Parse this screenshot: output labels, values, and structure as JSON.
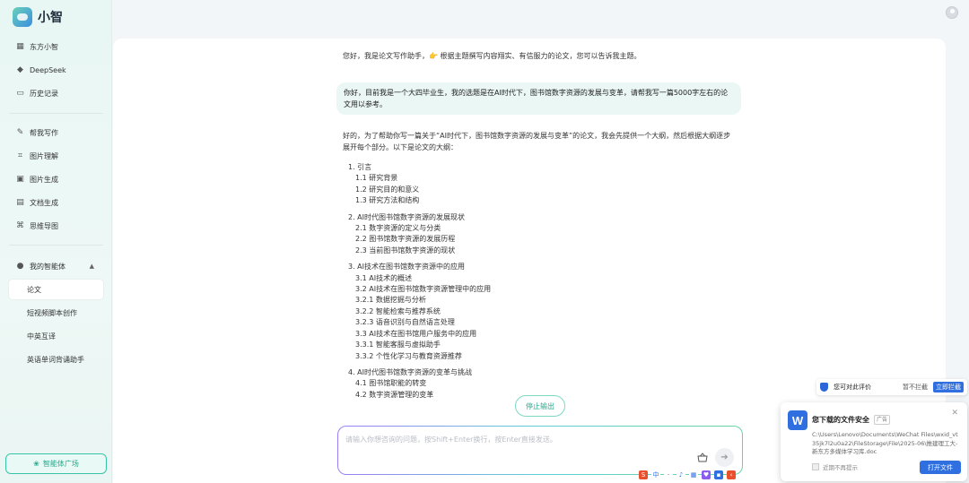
{
  "app": {
    "name": "小智"
  },
  "sidebar": {
    "top_items": [
      {
        "label": "东方小智",
        "icon": "grid-icon"
      },
      {
        "label": "DeepSeek",
        "icon": "whale-icon"
      },
      {
        "label": "历史记录",
        "icon": "history-icon"
      }
    ],
    "tool_items": [
      {
        "label": "帮我写作",
        "icon": "edit-icon"
      },
      {
        "label": "图片理解",
        "icon": "scan-icon"
      },
      {
        "label": "图片生成",
        "icon": "image-icon"
      },
      {
        "label": "文档生成",
        "icon": "document-icon"
      },
      {
        "label": "思维导图",
        "icon": "mindmap-icon"
      }
    ],
    "agents_header": "我的智能体",
    "agent_items": [
      "论文",
      "短视频脚本创作",
      "中英互译",
      "英语单词背诵助手"
    ],
    "square_button": "智能体广场"
  },
  "chat": {
    "greeting": "您好，我是论文写作助手，👉 根据主题撰写内容翔实、有信服力的论文，您可以告诉我主题。",
    "user_message": "你好，目前我是一个大四毕业生，我的选题是在AI时代下，图书馆数字资源的发展与变革，请帮我写一篇5000字左右的论文用以参考。",
    "reply_intro": "好的，为了帮助你写一篇关于“AI时代下，图书馆数字资源的发展与变革”的论文，我会先提供一个大纲，然后根据大纲逐步展开每个部分。以下是论文的大纲：",
    "outline": [
      {
        "head": "1. 引言",
        "items": [
          "1.1 研究背景",
          "1.2 研究目的和意义",
          "1.3 研究方法和结构"
        ]
      },
      {
        "head": "2. AI时代图书馆数字资源的发展现状",
        "items": [
          "2.1 数字资源的定义与分类",
          "2.2 图书馆数字资源的发展历程",
          "2.3 当前图书馆数字资源的现状"
        ]
      },
      {
        "head": "3. AI技术在图书馆数字资源中的应用",
        "items": [
          "3.1 AI技术的概述",
          "3.2 AI技术在图书馆数字资源管理中的应用",
          "3.2.1 数据挖掘与分析",
          "3.2.2 智能检索与推荐系统",
          "3.2.3 语音识别与自然语言处理",
          "3.3 AI技术在图书馆用户服务中的应用",
          "3.3.1 智能客服与虚拟助手",
          "3.3.2 个性化学习与教育资源推荐"
        ]
      },
      {
        "head": "4. AI时代图书馆数字资源的变革与挑战",
        "items": [
          "4.1 图书馆职能的转变",
          "4.2 数字资源管理的变革"
        ]
      }
    ],
    "stop_button": "停止输出",
    "input_placeholder": "请输入你想咨询的问题，按Shift+Enter换行，按Enter直接发送。"
  },
  "notifications": {
    "mini": {
      "text": "您可对此评价",
      "later": "暂不拦截",
      "action": "立即拦截"
    },
    "download": {
      "title": "您下载的文件安全",
      "tag": "广告",
      "path": "C:\\Users\\Lenovo\\Documents\\WeChat Files\\wxid_vt35jk7l2u0a22\\FileStorage\\File\\2025-06\\推建理工大-新东方多媒体学习库.doc",
      "checkbox": "近期不再提示",
      "button": "打开文件"
    }
  },
  "tray_icons": [
    "sogou-icon",
    "cn-icon",
    "dot-icon",
    "mic-icon",
    "keyboard-icon",
    "shirt-icon",
    "grid-icon",
    "more-icon"
  ],
  "colors": {
    "accent": "#2fb597",
    "sidebar_bg": "#e8f7f4",
    "bubble_bg": "#eaf7f5",
    "notify_blue": "#2f6fe0"
  }
}
